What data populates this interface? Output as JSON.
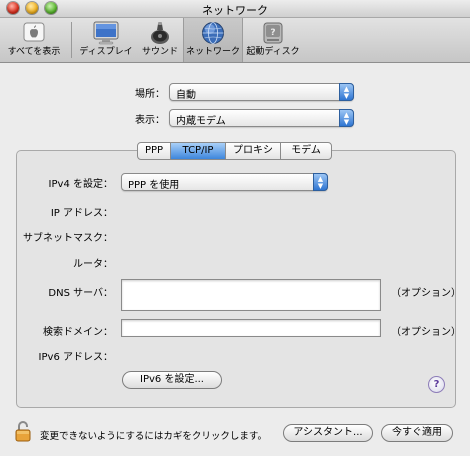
{
  "window": {
    "title": "ネットワーク"
  },
  "toolbar": {
    "items": [
      {
        "label": "すべてを表示",
        "icon": "apple-icon"
      },
      {
        "label": "ディスプレイ",
        "icon": "display-icon"
      },
      {
        "label": "サウンド",
        "icon": "speaker-icon"
      },
      {
        "label": "ネットワーク",
        "icon": "network-globe-icon"
      },
      {
        "label": "起動ディスク",
        "icon": "disk-icon"
      }
    ]
  },
  "location": {
    "label": "場所：",
    "value": "自動"
  },
  "show": {
    "label": "表示：",
    "value": "内蔵モデム"
  },
  "tabs": [
    "PPP",
    "TCP/IP",
    "プロキシ",
    "モデム"
  ],
  "tcpip": {
    "configure_label": "IPv4 を設定：",
    "configure_value": "PPP を使用",
    "ip_label": "IP アドレス：",
    "subnet_label": "サブネットマスク：",
    "router_label": "ルータ：",
    "dns_label": "DNS サーバ：",
    "dns_value": "",
    "dns_optional": "（オプション）",
    "search_label": "検索ドメイン：",
    "search_value": "",
    "search_optional": "（オプション）",
    "ipv6_label": "IPv6 アドレス：",
    "ipv6_button": "IPv6 を設定..."
  },
  "help": {
    "label": "?"
  },
  "footer": {
    "lock_text": "変更できないようにするにはカギをクリックします。",
    "assistant_button": "アシスタント...",
    "apply_button": "今すぐ適用"
  }
}
